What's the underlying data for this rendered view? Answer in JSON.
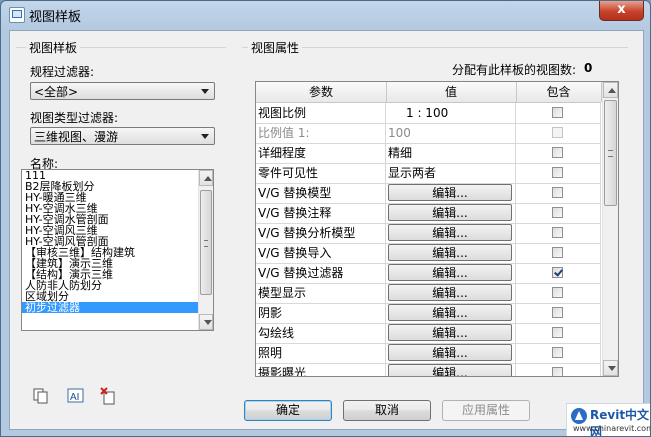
{
  "window": {
    "title": "视图样板",
    "close_glyph": "x"
  },
  "left_panel": {
    "group_label": "视图样板",
    "discipline_filter": {
      "label": "规程过滤器:",
      "value": "<全部>"
    },
    "view_type_filter": {
      "label": "视图类型过滤器:",
      "value": "三维视图、漫游"
    },
    "names_label": "名称:",
    "names": [
      "111",
      "B2层降板划分",
      "HY-暖通三维",
      "HY-空调水三维",
      "HY-空调水管剖面",
      "HY-空调风三维",
      "HY-空调风管剖面",
      "【审核三维】结构建筑",
      "【建筑】演示三维",
      "【结构】演示三维",
      "人防非人防划分",
      "区域划分",
      "初步过滤器"
    ],
    "selected_index": 12,
    "icons": [
      "duplicate-icon",
      "rename-icon",
      "delete-icon"
    ]
  },
  "right_panel": {
    "group_label": "视图属性",
    "count_label": "分配有此样板的视图数:",
    "count_value": "0",
    "columns": [
      "参数",
      "值",
      "包含"
    ],
    "rows": [
      {
        "param": "视图比例",
        "value": "1 : 100",
        "type": "text",
        "checked": false,
        "disabled": false
      },
      {
        "param": "比例值 1:",
        "value": "100",
        "type": "text",
        "checked": false,
        "disabled": true
      },
      {
        "param": "详细程度",
        "value": "精细",
        "type": "text",
        "checked": false,
        "disabled": false
      },
      {
        "param": "零件可见性",
        "value": "显示两者",
        "type": "text",
        "checked": false,
        "disabled": false
      },
      {
        "param": "V/G 替换模型",
        "value": "编辑...",
        "type": "button",
        "checked": false,
        "disabled": false
      },
      {
        "param": "V/G 替换注释",
        "value": "编辑...",
        "type": "button",
        "checked": false,
        "disabled": false
      },
      {
        "param": "V/G 替换分析模型",
        "value": "编辑...",
        "type": "button",
        "checked": false,
        "disabled": false
      },
      {
        "param": "V/G 替换导入",
        "value": "编辑...",
        "type": "button",
        "checked": false,
        "disabled": false
      },
      {
        "param": "V/G 替换过滤器",
        "value": "编辑...",
        "type": "button",
        "checked": true,
        "disabled": false
      },
      {
        "param": "模型显示",
        "value": "编辑...",
        "type": "button",
        "checked": false,
        "disabled": false
      },
      {
        "param": "阴影",
        "value": "编辑...",
        "type": "button",
        "checked": false,
        "disabled": false
      },
      {
        "param": "勾绘线",
        "value": "编辑...",
        "type": "button",
        "checked": false,
        "disabled": false
      },
      {
        "param": "照明",
        "value": "编辑...",
        "type": "button",
        "checked": false,
        "disabled": false
      },
      {
        "param": "摄影曝光",
        "value": "编辑...",
        "type": "button",
        "checked": false,
        "disabled": false
      }
    ]
  },
  "buttons": {
    "ok": "确定",
    "cancel": "取消",
    "apply": "应用属性"
  },
  "watermark": {
    "brand": "Revit中文网",
    "url": "www.chinarevit.com"
  },
  "colors": {
    "selection": "#3399ff",
    "title_gradient_top": "#c3d6ea",
    "close_red": "#c7432c"
  }
}
